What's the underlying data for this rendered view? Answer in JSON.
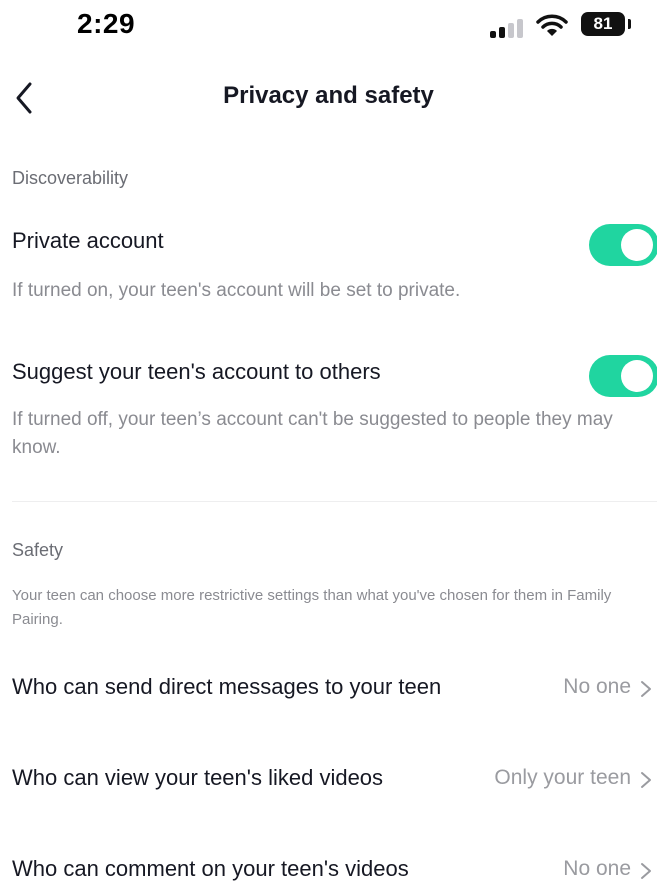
{
  "status_bar": {
    "time": "2:29",
    "battery": "81"
  },
  "header": {
    "title": "Privacy and safety",
    "back_icon": "chevron-left-icon"
  },
  "discoverability": {
    "section_title": "Discoverability",
    "private_account": {
      "label": "Private account",
      "description": "If turned on, your teen's account will be set to private.",
      "enabled": true
    },
    "suggest_account": {
      "label": "Suggest your teen's account to others",
      "description": "If turned off, your teen’s account can't be suggested to people they may know.",
      "enabled": true
    }
  },
  "safety": {
    "section_title": "Safety",
    "description": "Your teen can choose more restrictive settings than what you've chosen for them in Family Pairing.",
    "rows": [
      {
        "label": "Who can send direct messages to your teen",
        "value": "No one"
      },
      {
        "label": "Who can view your teen's liked videos",
        "value": "Only your teen"
      },
      {
        "label": "Who can comment on your teen's videos",
        "value": "No one"
      }
    ]
  },
  "colors": {
    "toggle_on": "#20d5a0",
    "text_primary": "#161823",
    "text_secondary": "#8a8b91"
  }
}
